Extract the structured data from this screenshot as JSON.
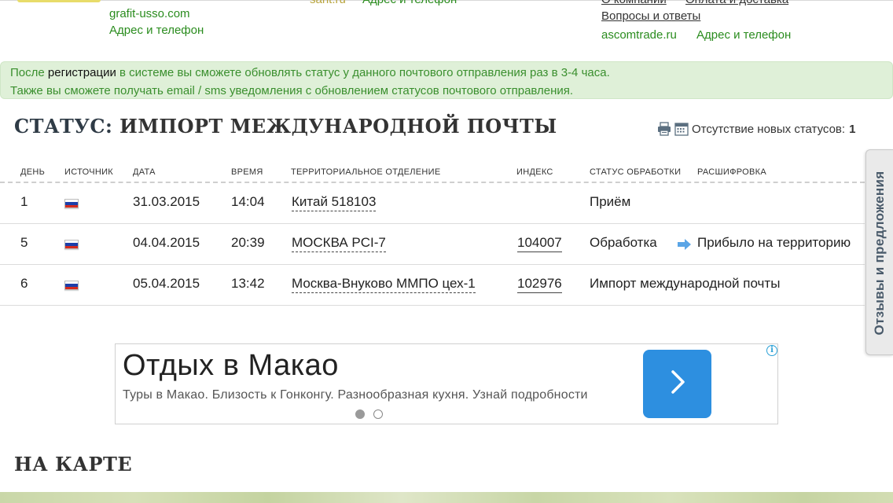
{
  "top": {
    "left_site": "grafit-usso.com",
    "left_addr": "Адрес и телефон",
    "mid_site": "sant.ru",
    "mid_addr": "Адрес и телефон",
    "right_about": "О компании",
    "right_payment": "Оплата и доставка",
    "right_faq": "Вопросы и ответы",
    "right_site": "ascomtrade.ru",
    "right_addr": "Адрес и телефон"
  },
  "info": {
    "line1_pre": "После ",
    "line1_link": "регистрации",
    "line1_post": " в системе вы сможете обновлять статус у данного почтового отправления раз в 3-4 часа.",
    "line2": "Также вы сможете получать email / sms уведомления с обновлением статусов почтового отправления."
  },
  "status": {
    "prefix": "СТАТУС:",
    "value": " ИМПОРТ МЕЖДУНАРОДНОЙ ПОЧТЫ",
    "no_new_label": "Отсутствие новых статусов:",
    "no_new_count": "1",
    "print_icon": "printer-icon",
    "calendar_icon": "calendar-icon"
  },
  "table": {
    "headers": {
      "day": "ДЕНЬ",
      "source": "ИСТОЧНИК",
      "date": "ДАТА",
      "time": "ВРЕМЯ",
      "office": "ТЕРРИТОРИАЛЬНОЕ ОТДЕЛЕНИЕ",
      "index": "ИНДЕКС",
      "proc_status": "СТАТУС ОБРАБОТКИ",
      "decode": "РАСШИФРОВКА"
    },
    "rows": [
      {
        "day": "1",
        "source_flag": "russia-flag",
        "date": "31.03.2015",
        "time": "14:04",
        "office": "Китай 518103",
        "index": "",
        "status": "Приём",
        "decode": ""
      },
      {
        "day": "5",
        "source_flag": "russia-flag",
        "date": "04.04.2015",
        "time": "20:39",
        "office": "МОСКВА PCI-7",
        "index": "104007",
        "status": "Обработка",
        "decode": "Прибыло на территорию"
      },
      {
        "day": "6",
        "source_flag": "russia-flag",
        "date": "05.04.2015",
        "time": "13:42",
        "office": "Москва-Внуково ММПО цех-1",
        "index": "102976",
        "status": "Импорт международной почты",
        "decode": ""
      }
    ]
  },
  "side_tab": {
    "label": "Отзывы и предложения"
  },
  "ad": {
    "title": "Отдых в Макао",
    "description": "Туры в Макао. Близость к Гонконгу. Разнообразная кухня. Узнай подробности",
    "info_glyph": "i",
    "button_icon": "chevron-right-icon"
  },
  "map": {
    "heading": "НА КАРТЕ"
  },
  "colors": {
    "green_text": "#2a8c1e",
    "info_bg": "#dff0d8",
    "ad_button": "#2d8fe0",
    "side_tab_text": "#4a5b6b"
  }
}
